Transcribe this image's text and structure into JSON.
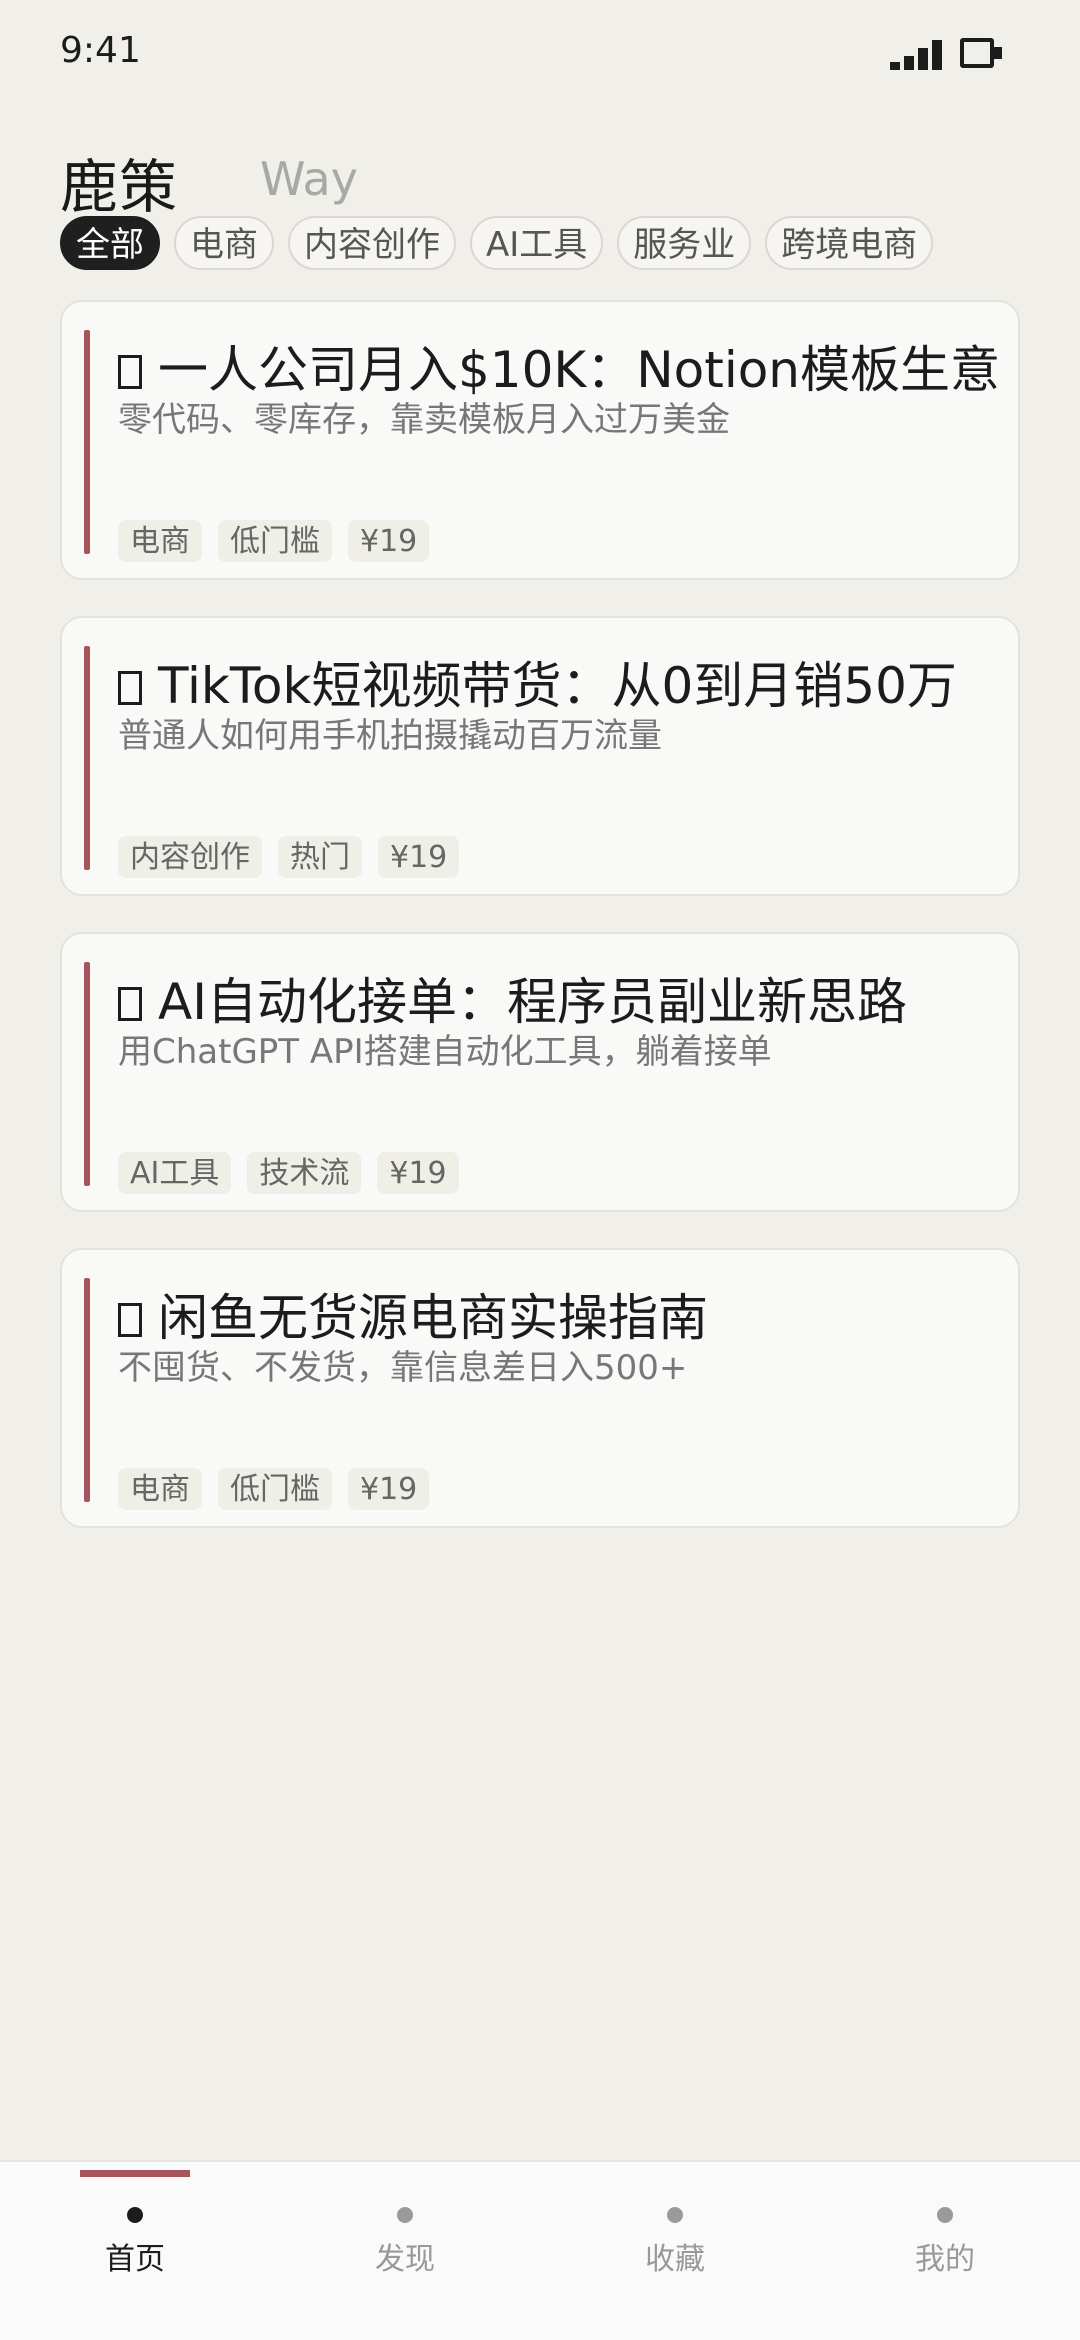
{
  "status_bar": {
    "time": "9:41"
  },
  "header": {
    "brand": "鹿策",
    "brand_en": "Way"
  },
  "filters": [
    {
      "label": "全部",
      "active": true
    },
    {
      "label": "电商",
      "active": false
    },
    {
      "label": "内容创作",
      "active": false
    },
    {
      "label": "AI工具",
      "active": false
    },
    {
      "label": "服务业",
      "active": false
    },
    {
      "label": "跨境电商",
      "active": false
    }
  ],
  "cards": [
    {
      "title": "一人公司月入$10K：Notion模板生意",
      "subtitle": "零代码、零库存，靠卖模板月入过万美金",
      "tags": [
        "电商",
        "低门槛",
        "¥19"
      ]
    },
    {
      "title": "TikTok短视频带货：从0到月销50万",
      "subtitle": "普通人如何用手机拍摄撬动百万流量",
      "tags": [
        "内容创作",
        "热门",
        "¥19"
      ]
    },
    {
      "title": "AI自动化接单：程序员副业新思路",
      "subtitle": "用ChatGPT API搭建自动化工具，躺着接单",
      "tags": [
        "AI工具",
        "技术流",
        "¥19"
      ]
    },
    {
      "title": "闲鱼无货源电商实操指南",
      "subtitle": "不囤货、不发货，靠信息差日入500+",
      "tags": [
        "电商",
        "低门槛",
        "¥19"
      ]
    }
  ],
  "bottom_nav": [
    {
      "label": "首页",
      "active": true
    },
    {
      "label": "发现",
      "active": false
    },
    {
      "label": "收藏",
      "active": false
    },
    {
      "label": "我的",
      "active": false
    }
  ],
  "colors": {
    "background": "#f0efea",
    "accent": "#a8545a",
    "active_chip": "#1f1f1f"
  }
}
